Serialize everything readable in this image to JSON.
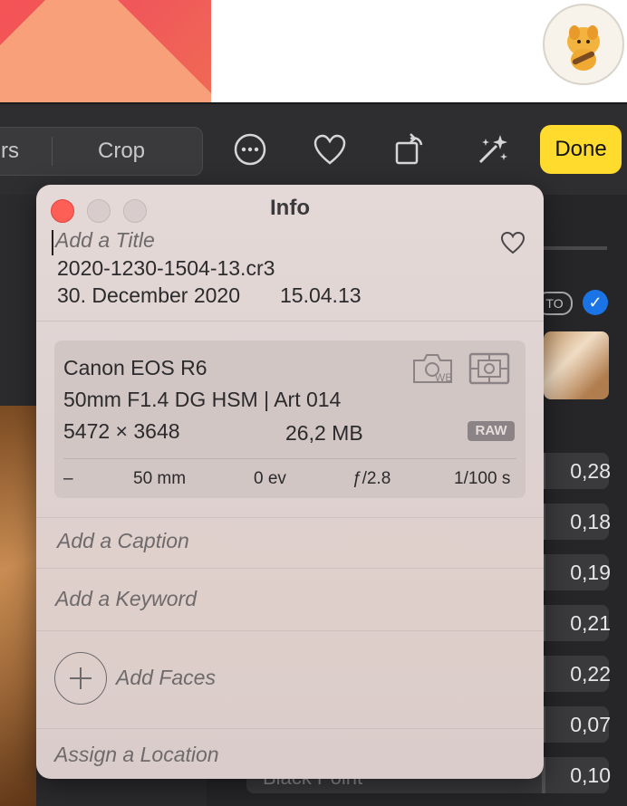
{
  "toolbar": {
    "segment_left_label": "rs",
    "crop_label": "Crop",
    "done_label": "Done",
    "icons": [
      "more-icon",
      "heart-icon",
      "rotate-icon",
      "magic-wand-icon"
    ]
  },
  "adjust_panel": {
    "auto_label": "TO",
    "thumb": "photo-thumbnail",
    "values": [
      "0,28",
      "0,18",
      "0,19",
      "0,21",
      "0,22",
      "0,07",
      "0,10"
    ],
    "last_label": "Black Point"
  },
  "info": {
    "title": "Info",
    "title_placeholder": "Add a Title",
    "filename": "2020-1230-1504-13.cr3",
    "date": "30. December 2020",
    "time": "15.04.13",
    "camera": "Canon EOS R6",
    "lens": "50mm F1.4 DG HSM | Art 014",
    "dimensions": "5472 × 3648",
    "filesize": "26,2 MB",
    "format_badge": "RAW",
    "wb_label": "WB",
    "exif": {
      "iso": "–",
      "focal_length": "50 mm",
      "exposure_bias": "0 ev",
      "aperture": "ƒ/2.8",
      "shutter": "1/100 s"
    },
    "caption_placeholder": "Add a Caption",
    "keyword_placeholder": "Add a Keyword",
    "faces_label": "Add Faces",
    "location_placeholder": "Assign a Location"
  },
  "colors": {
    "done_bg": "#fedb2d",
    "close_red": "#fd5f57",
    "checkbox_blue": "#1b74e6"
  }
}
